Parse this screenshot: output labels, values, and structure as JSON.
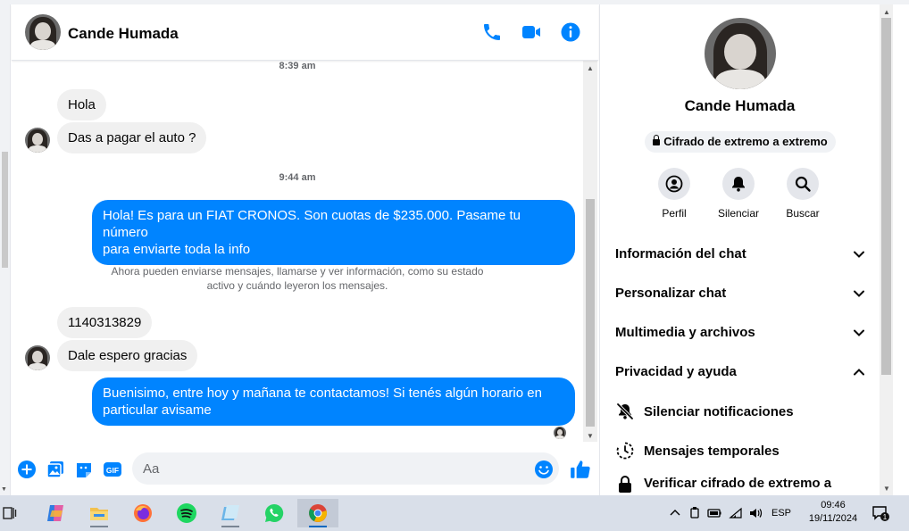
{
  "chat": {
    "contact_name": "Cande Humada",
    "messages": {
      "top_time": "8:39 am",
      "msg1": "Hola",
      "msg2": "Das a pagar el auto ?",
      "time2": "9:44 am",
      "msg3_line1": "Hola! Es para un FIAT CRONOS. Son cuotas de $235.000. Pasame tu número",
      "msg3_line2": "para enviarte toda la info",
      "system_line1": "Ahora pueden enviarse mensajes, llamarse y ver información, como su estado",
      "system_line2": "activo y cuándo leyeron los mensajes.",
      "msg4": "1140313829",
      "msg5": "Dale espero gracias",
      "msg6_line1": "Buenisimo, entre hoy y mañana te contactamos! Si tenés algún horario en",
      "msg6_line2": "particular avisame"
    },
    "composer": {
      "placeholder": "Aa"
    }
  },
  "panel": {
    "name": "Cande Humada",
    "encryption_badge": "Cifrado de extremo a extremo",
    "actions": {
      "profile": "Perfil",
      "mute": "Silenciar",
      "search": "Buscar"
    },
    "sections": {
      "chat_info": "Información del chat",
      "customize": "Personalizar chat",
      "media": "Multimedia y archivos",
      "privacy": "Privacidad y ayuda"
    },
    "privacy_items": {
      "mute_notifications": "Silenciar notificaciones",
      "disappearing": "Mensajes temporales",
      "verify": "Verificar cifrado de extremo a"
    }
  },
  "taskbar": {
    "language": "ESP",
    "time": "09:46",
    "date": "19/11/2024",
    "notification_count": "1"
  },
  "colors": {
    "messenger_blue": "#0084ff",
    "incoming_bubble": "#f0f0f0",
    "taskbar": "#d9dfe9"
  }
}
